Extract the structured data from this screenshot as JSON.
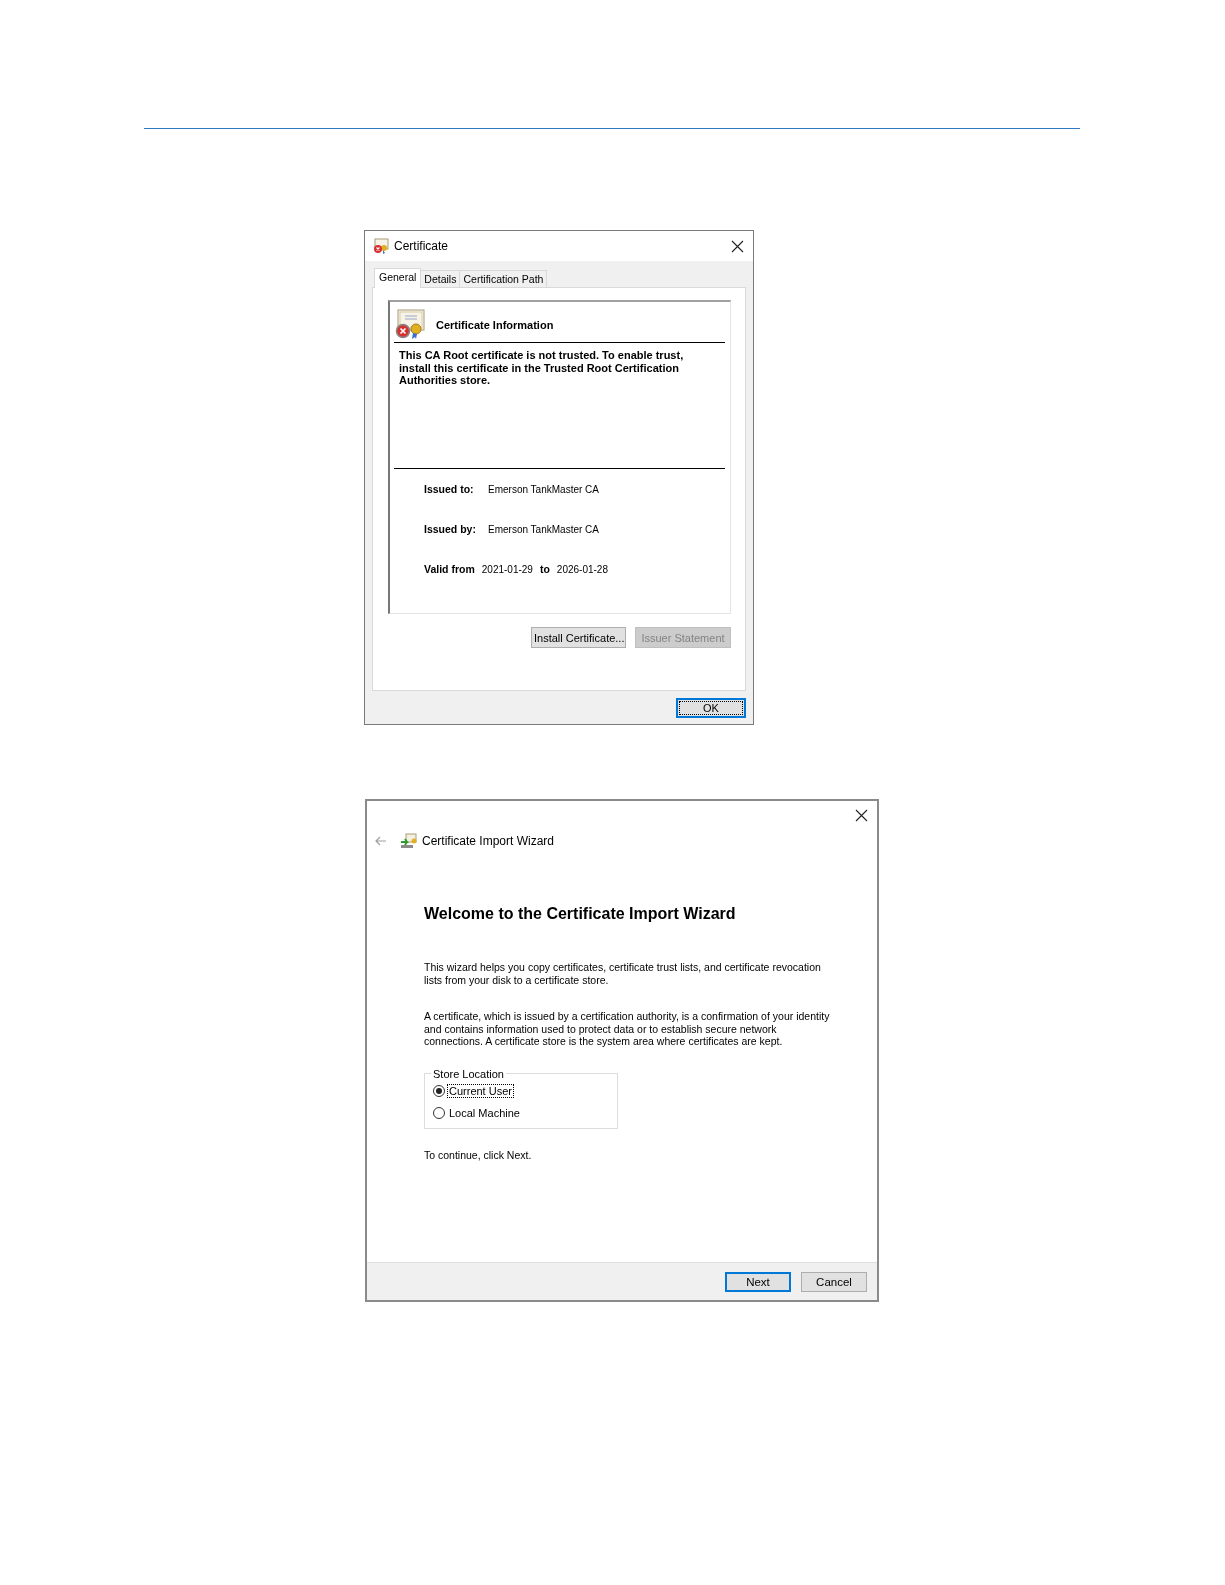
{
  "certificate_dialog": {
    "title": "Certificate",
    "tabs": [
      {
        "label": "General",
        "selected": true
      },
      {
        "label": "Details",
        "selected": false
      },
      {
        "label": "Certification Path",
        "selected": false
      }
    ],
    "info_heading": "Certificate Information",
    "message": "This CA Root certificate is not trusted. To enable trust, install this certificate in the Trusted Root Certification Authorities store.",
    "issued_to": {
      "label": "Issued to:",
      "value": "Emerson TankMaster CA"
    },
    "issued_by": {
      "label": "Issued by:",
      "value": "Emerson TankMaster CA"
    },
    "validity": {
      "from_label": "Valid from",
      "from": "2021-01-29",
      "to_label": "to",
      "to": "2026-01-28"
    },
    "buttons": [
      {
        "label": "Install Certificate...",
        "disabled": false
      },
      {
        "label": "Issuer Statement",
        "disabled": true
      }
    ],
    "ok_button": {
      "label": "OK",
      "default": true
    }
  },
  "wizard": {
    "title": "Certificate Import Wizard",
    "heading": "Welcome to the Certificate Import Wizard",
    "paragraphs": [
      "This wizard helps you copy certificates, certificate trust lists, and certificate revocation lists from your disk to a certificate store.",
      "A certificate, which is issued by a certification authority, is a confirmation of your identity and contains information used to protect data or to establish secure network connections. A certificate store is the system area where certificates are kept."
    ],
    "store_location": {
      "legend": "Store Location",
      "options": [
        {
          "label": "Current User",
          "selected": true
        },
        {
          "label": "Local Machine",
          "selected": false
        }
      ]
    },
    "continue_hint": "To continue, click Next.",
    "buttons": [
      {
        "label": "Next",
        "default": true
      },
      {
        "label": "Cancel",
        "default": false
      }
    ]
  }
}
